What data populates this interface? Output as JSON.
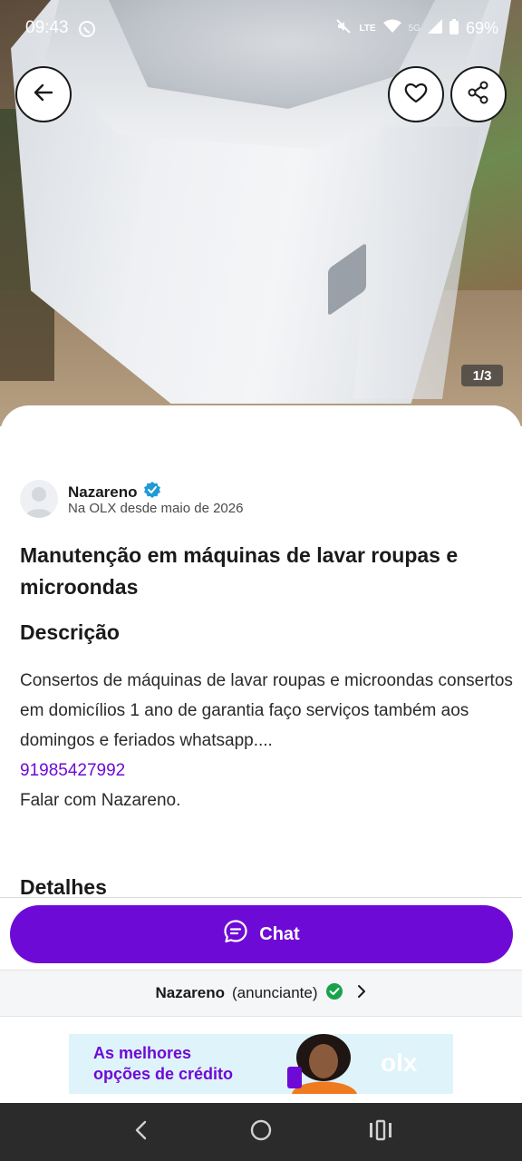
{
  "status_bar": {
    "time": "09:43",
    "network": "5G",
    "lte": "LTE",
    "battery": "69%"
  },
  "gallery": {
    "counter": "1/3"
  },
  "seller": {
    "name": "Nazareno",
    "since": "Na OLX desde maio de 2026",
    "verified": true
  },
  "listing": {
    "title": "Manutenção em máquinas de lavar roupas e microondas",
    "description_heading": "Descrição",
    "description": "Consertos de máquinas de lavar roupas e microondas consertos em domicílios 1 ano de garantia faço serviços também aos domingos e feriados whatsapp....",
    "phone": "91985427992",
    "contact_line": "Falar com Nazareno.",
    "details_heading": "Detalhes"
  },
  "actions": {
    "chat_label": "Chat"
  },
  "seller_bar": {
    "name": "Nazareno",
    "role": "(anunciante)"
  },
  "ad": {
    "line1": "As melhores",
    "line2": "opções de crédito",
    "logo": "olx"
  },
  "colors": {
    "primary": "#6e0ad6",
    "verified": "#1f9bd7",
    "success": "#18a34a"
  },
  "icons": {
    "back": "arrow-left-icon",
    "favorite": "heart-icon",
    "share": "share-icon",
    "chat": "chat-bubble-icon",
    "verified": "verified-badge-icon",
    "check": "check-circle-icon",
    "chevron": "chevron-right-icon"
  }
}
